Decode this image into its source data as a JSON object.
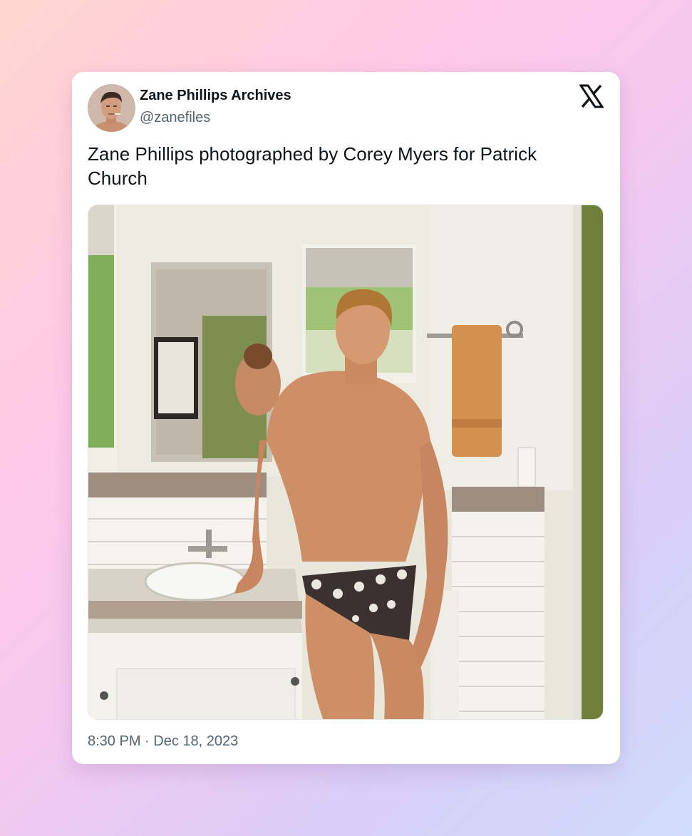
{
  "tweet": {
    "author_name": "Zane Phillips Archives",
    "author_handle": "@zanefiles",
    "text": "Zane Phillips photographed by Corey Myers for Patrick Church",
    "timestamp": "8:30 PM · Dec 18, 2023"
  },
  "icons": {
    "platform_logo": "x-logo-icon",
    "avatar": "avatar-photo"
  },
  "media": {
    "description_type": "photo"
  },
  "colors": {
    "card_background": "#ffffff",
    "name_text": "#0f1419",
    "secondary_text": "#536471"
  }
}
